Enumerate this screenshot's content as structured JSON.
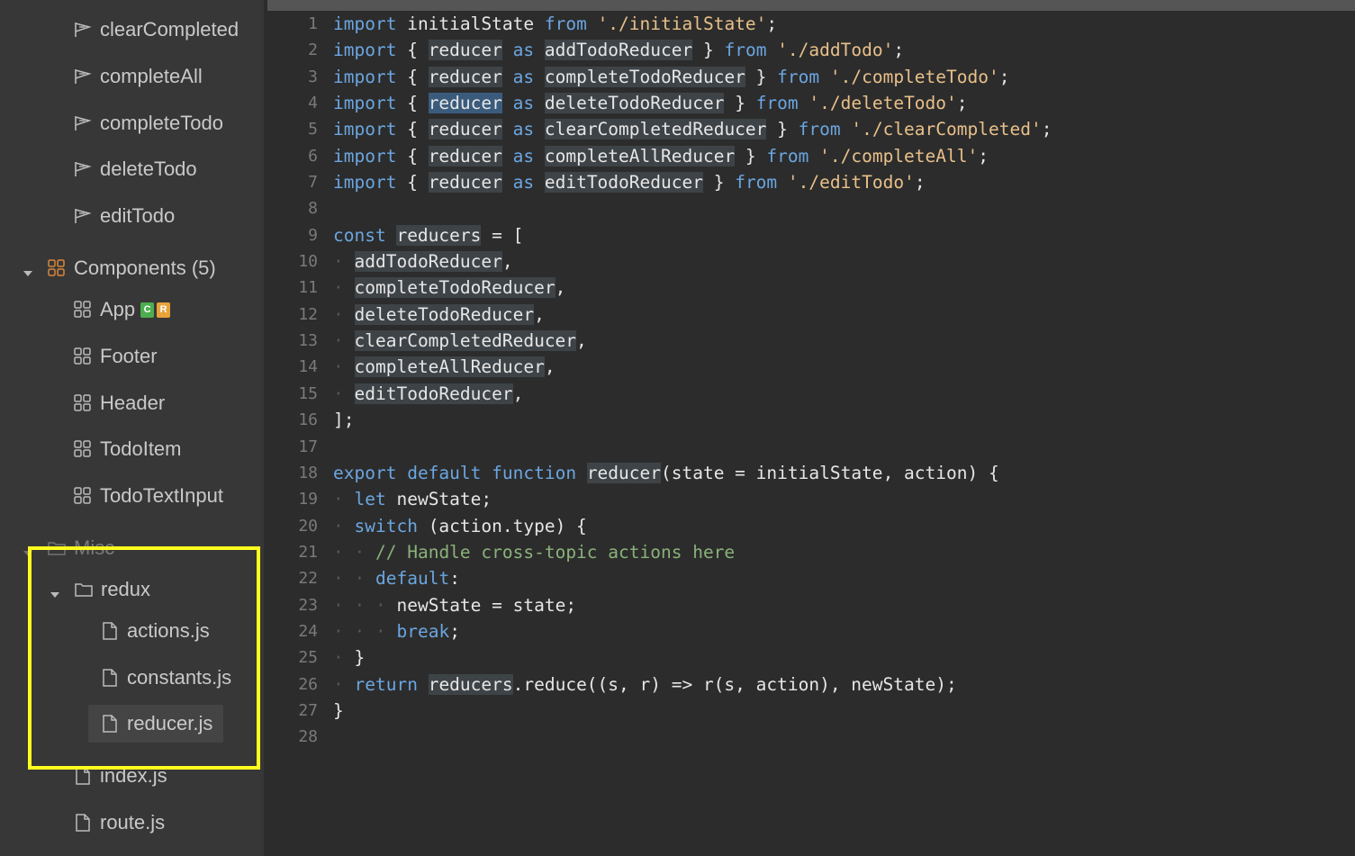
{
  "sidebar": {
    "items": [
      {
        "label": "clearCompleted",
        "icon": "reducer-flag-icon",
        "indent": 1
      },
      {
        "label": "completeAll",
        "icon": "reducer-flag-icon",
        "indent": 1
      },
      {
        "label": "completeTodo",
        "icon": "reducer-flag-icon",
        "indent": 1
      },
      {
        "label": "deleteTodo",
        "icon": "reducer-flag-icon",
        "indent": 1
      },
      {
        "label": "editTodo",
        "icon": "reducer-flag-icon",
        "indent": 1
      },
      {
        "label": "Components (5)",
        "icon": "component-grid-icon",
        "indent": 0
      },
      {
        "label": "App",
        "icon": "component-grid-icon",
        "indent": 1
      },
      {
        "label": "Footer",
        "icon": "component-grid-icon",
        "indent": 1
      },
      {
        "label": "Header",
        "icon": "component-grid-icon",
        "indent": 1
      },
      {
        "label": "TodoItem",
        "icon": "component-grid-icon",
        "indent": 1
      },
      {
        "label": "TodoTextInput",
        "icon": "component-grid-icon",
        "indent": 1
      },
      {
        "label": "Misc",
        "icon": "folder-icon",
        "indent": 0
      },
      {
        "label": "redux",
        "icon": "folder-icon",
        "indent": 1
      },
      {
        "label": "actions.js",
        "icon": "file-icon",
        "indent": 2
      },
      {
        "label": "constants.js",
        "icon": "file-icon",
        "indent": 2
      },
      {
        "label": "reducer.js",
        "icon": "file-icon",
        "indent": 2
      },
      {
        "label": "index.js",
        "icon": "file-icon",
        "indent": 1
      },
      {
        "label": "route.js",
        "icon": "file-icon",
        "indent": 1
      }
    ],
    "badges": {
      "c": "C",
      "r": "R"
    },
    "colors": {
      "badge_c": "#4cae4f",
      "badge_r": "#e8a33a",
      "component_icon": "#d9873a",
      "highlight": "#ffff1f"
    }
  },
  "editor": {
    "lines": [
      "1",
      "2",
      "3",
      "4",
      "5",
      "6",
      "7",
      "8",
      "9",
      "10",
      "11",
      "12",
      "13",
      "14",
      "15",
      "16",
      "17",
      "18",
      "19",
      "20",
      "21",
      "22",
      "23",
      "24",
      "25",
      "26",
      "27",
      "28"
    ],
    "tokens": {
      "import": "import",
      "from": "from",
      "as": "as",
      "reducer": "reducer",
      "initialState": "initialState",
      "str_initialState": "'./initialState'",
      "addTodoReducer": "addTodoReducer",
      "str_addTodo": "'./addTodo'",
      "completeTodoReducer": "completeTodoReducer",
      "str_completeTodo": "'./completeTodo'",
      "deleteTodoReducer": "deleteTodoReducer",
      "str_deleteTodo": "'./deleteTodo'",
      "clearCompletedReducer": "clearCompletedReducer",
      "str_clearCompleted": "'./clearCompleted'",
      "completeAllReducer": "completeAllReducer",
      "str_completeAll": "'./completeAll'",
      "editTodoReducer": "editTodoReducer",
      "str_editTodo": "'./editTodo'",
      "const": "const",
      "reducers": "reducers",
      "export": "export",
      "default": "default",
      "function": "function",
      "let": "let",
      "switch": "switch",
      "break": "break",
      "return": "return",
      "comment": "// Handle cross-topic actions here"
    }
  }
}
